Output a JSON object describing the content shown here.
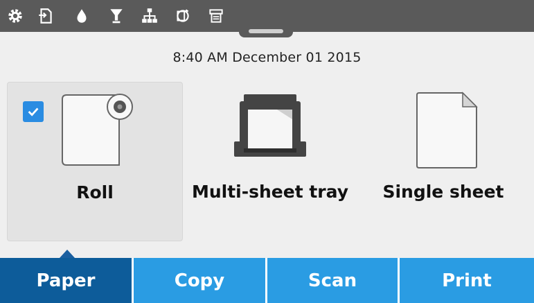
{
  "status_bar": {
    "icons": [
      "gear-icon",
      "document-icon",
      "ink-drop-icon",
      "printhead-icon",
      "network-icon",
      "paper-source-icon",
      "job-queue-icon"
    ]
  },
  "datetime": "8:40 AM December 01 2015",
  "sources": [
    {
      "label": "Roll",
      "icon": "roll-paper-icon",
      "selected": true
    },
    {
      "label": "Multi-sheet tray",
      "icon": "multi-sheet-tray-icon",
      "selected": false
    },
    {
      "label": "Single sheet",
      "icon": "single-sheet-icon",
      "selected": false
    }
  ],
  "tabs": [
    {
      "label": "Paper",
      "active": true
    },
    {
      "label": "Copy",
      "active": false
    },
    {
      "label": "Scan",
      "active": false
    },
    {
      "label": "Print",
      "active": false
    }
  ],
  "colors": {
    "status_bar": "#5a5a5a",
    "tab": "#2a9ce3",
    "tab_active": "#0d5c9a",
    "checkbox": "#2a8ce2"
  }
}
